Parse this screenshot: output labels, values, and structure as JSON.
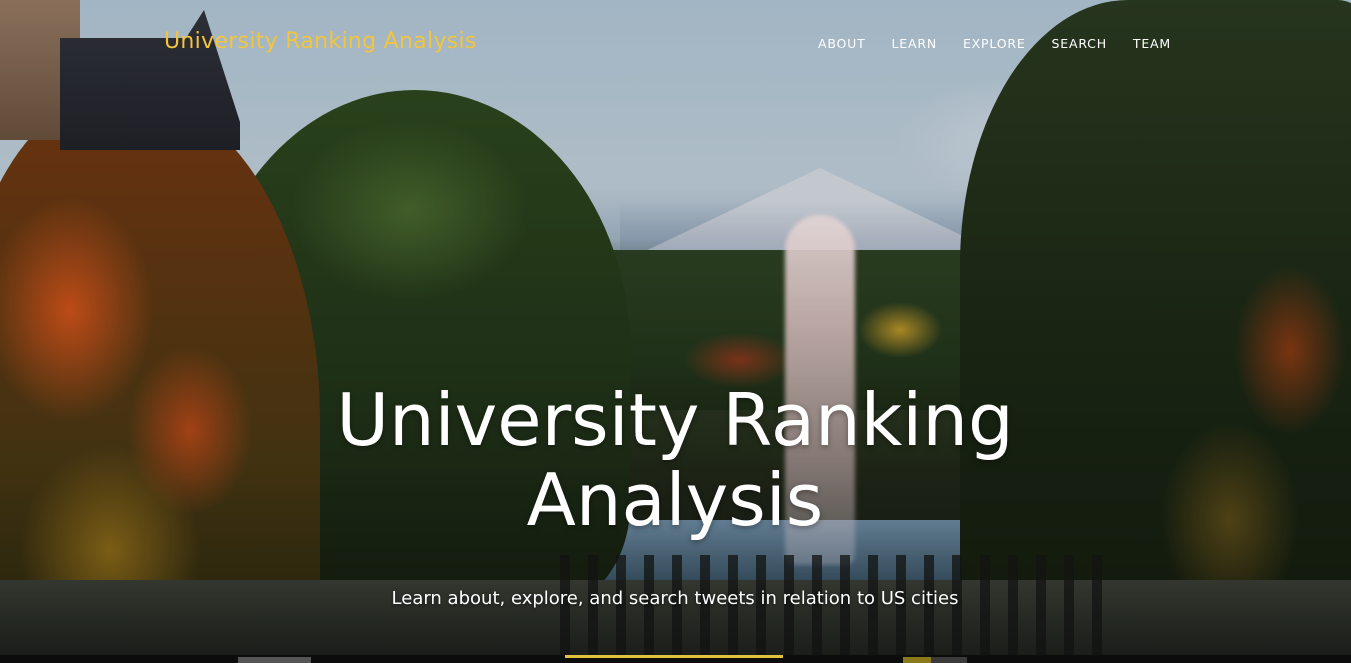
{
  "navbar": {
    "brand": "University Ranking Analysis",
    "links": [
      {
        "label": "ABOUT"
      },
      {
        "label": "LEARN"
      },
      {
        "label": "EXPLORE"
      },
      {
        "label": "SEARCH"
      },
      {
        "label": "TEAM"
      }
    ]
  },
  "hero": {
    "title_line1": "University Ranking",
    "title_line2": "Analysis",
    "subtitle": "Learn about, explore, and search tweets in relation to US cities"
  },
  "colors": {
    "brand": "#f2c53d",
    "nav_text": "#ffffff",
    "hero_text": "#ffffff"
  }
}
